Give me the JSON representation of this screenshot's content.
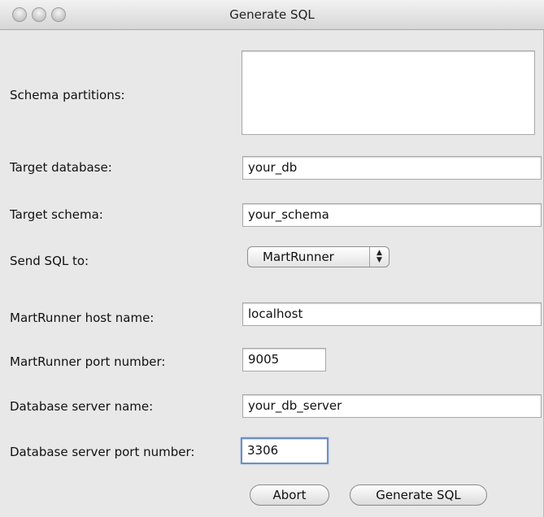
{
  "window": {
    "title": "Generate SQL"
  },
  "form": {
    "schema_partitions_label": "Schema partitions:",
    "target_database_label": "Target database:",
    "target_database_value": "your_db",
    "target_schema_label": "Target schema:",
    "target_schema_value": "your_schema",
    "send_sql_to_label": "Send SQL to:",
    "send_sql_to_selected": "MartRunner",
    "martrunner_host_label": "MartRunner host name:",
    "martrunner_host_value": "localhost",
    "martrunner_port_label": "MartRunner port number:",
    "martrunner_port_value": "9005",
    "db_server_name_label": "Database server name:",
    "db_server_name_value": "your_db_server",
    "db_server_port_label": "Database server port number:",
    "db_server_port_value": "3306"
  },
  "buttons": {
    "abort_label": "Abort",
    "generate_label": "Generate SQL"
  }
}
